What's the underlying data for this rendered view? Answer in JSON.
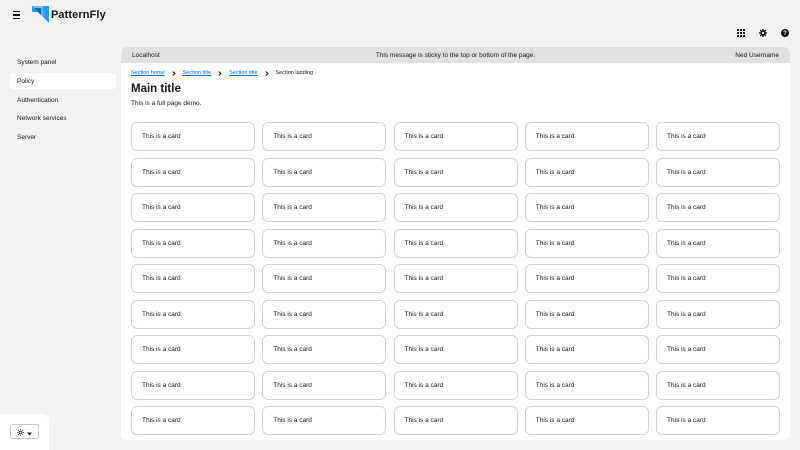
{
  "brand": {
    "name": "PatternFly"
  },
  "toolbar": {
    "icons": [
      "grid-icon",
      "gear-icon",
      "help-icon"
    ]
  },
  "sidebar": {
    "items": [
      {
        "label": "System panel",
        "active": false
      },
      {
        "label": "Policy",
        "active": true
      },
      {
        "label": "Authentication",
        "active": false
      },
      {
        "label": "Network services",
        "active": false
      },
      {
        "label": "Server",
        "active": false
      }
    ]
  },
  "banner": {
    "left": "Localhost",
    "center": "This message is sticky to the top or bottom of the page.",
    "right": "Ned Username"
  },
  "breadcrumb": {
    "items": [
      "Section home",
      "Section title",
      "Section title"
    ],
    "current": "Section landing"
  },
  "page": {
    "title": "Main title",
    "description": "This is a full page demo."
  },
  "cards": [
    "This is a card",
    "This is a card",
    "This is a card",
    "This is a card",
    "This is a card",
    "This is a card",
    "This is a card",
    "This is a card",
    "This is a card",
    "This is a card",
    "This is a card",
    "This is a card",
    "This is a card",
    "This is a card",
    "This is a card",
    "This is a card",
    "This is a card",
    "This is a card",
    "This is a card",
    "This is a card",
    "This is a card",
    "This is a card",
    "This is a card",
    "This is a card",
    "This is a card",
    "This is a card",
    "This is a card",
    "This is a card",
    "This is a card",
    "This is a card",
    "This is a card",
    "This is a card",
    "This is a card",
    "This is a card",
    "This is a card",
    "This is a card",
    "This is a card",
    "This is a card",
    "This is a card",
    "This is a card",
    "This is a card",
    "This is a card",
    "This is a card",
    "This is a card",
    "This is a card"
  ],
  "theme_switcher": {
    "icon": "sun-icon"
  },
  "colors": {
    "link": "#0066cc",
    "banner": "#e0e0e0",
    "logo": "#2b9af3"
  }
}
